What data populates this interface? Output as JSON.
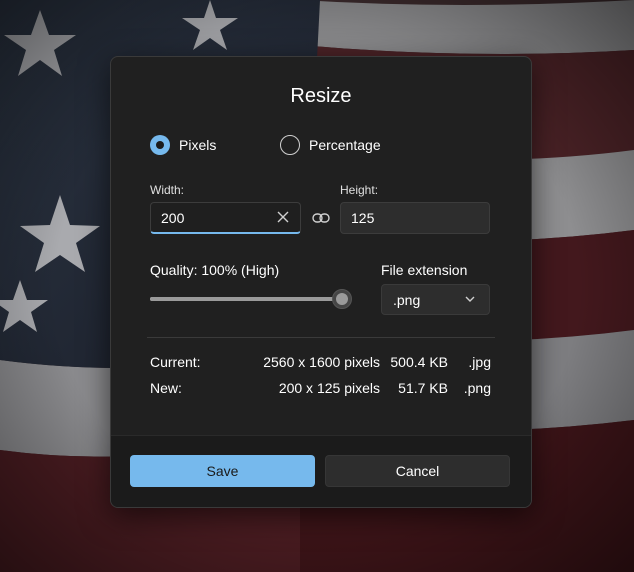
{
  "dialog": {
    "title": "Resize",
    "mode": {
      "pixels_label": "Pixels",
      "percentage_label": "Percentage",
      "selected": "Pixels"
    },
    "width": {
      "label": "Width:",
      "value": "200"
    },
    "height": {
      "label": "Height:",
      "value": "125"
    },
    "quality": {
      "label": "Quality: 100% (High)",
      "percent": 100
    },
    "file_extension": {
      "label": "File extension",
      "selected": ".png"
    },
    "info": {
      "current": {
        "label": "Current:",
        "dimensions": "2560 x 1600 pixels",
        "size": "500.4 KB",
        "ext": ".jpg"
      },
      "new": {
        "label": "New:",
        "dimensions": "200 x 125 pixels",
        "size": "51.7 KB",
        "ext": ".png"
      }
    },
    "buttons": {
      "save": "Save",
      "cancel": "Cancel"
    }
  },
  "icons": {
    "clear": "close-icon",
    "lock_ratio": "link-icon",
    "dropdown": "chevron-down-icon"
  },
  "colors": {
    "accent": "#76b9ed",
    "dialog_bg": "#202020",
    "footer_bg": "#1b1b1b"
  }
}
